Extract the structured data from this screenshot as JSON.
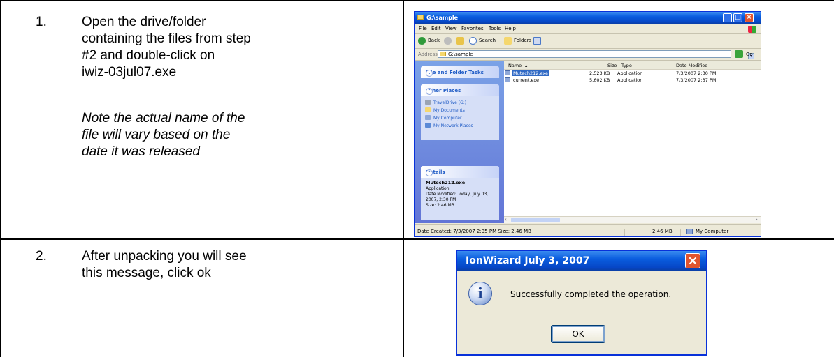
{
  "steps": [
    {
      "number": "1.",
      "lines": [
        "Open the drive/folder",
        "containing the files from step",
        "#2 and double-click on",
        "iwiz-03jul07.exe"
      ],
      "note_lines": [
        "Note the actual name of the",
        "file will vary based on the",
        "date it was released"
      ]
    },
    {
      "number": "2.",
      "lines": [
        "After unpacking you will see",
        "this message, click ok"
      ]
    }
  ],
  "explorer": {
    "title": "G:\\sample",
    "menu": [
      "File",
      "Edit",
      "View",
      "Favorites",
      "Tools",
      "Help"
    ],
    "toolbar": {
      "back": "Back",
      "search": "Search",
      "folders": "Folders"
    },
    "address": {
      "label": "Address",
      "path": "G:\\sample",
      "go": "Go"
    },
    "tasks": {
      "file_folder_tasks": "File and Folder Tasks",
      "other_places": "Other Places",
      "places": [
        "TravelDrive (G:)",
        "My Documents",
        "My Computer",
        "My Network Places"
      ],
      "details": {
        "header": "Details",
        "name": "Mutech212.exe",
        "type": "Application",
        "modified": "Date Modified: Today, July 03, 2007, 2:30 PM",
        "size": "Size: 2.46 MB"
      }
    },
    "columns": [
      "Name",
      "Size",
      "Type",
      "Date Modified"
    ],
    "files": [
      {
        "name": "Mutech212.exe",
        "size": "2,523 KB",
        "type": "Application",
        "modified": "7/3/2007 2:30 PM"
      },
      {
        "name": "current.exe",
        "size": "5,602 KB",
        "type": "Application",
        "modified": "7/3/2007 2:37 PM"
      }
    ],
    "status": {
      "left": "Date Created: 7/3/2007 2:35 PM Size: 2.46 MB",
      "size": "2.46 MB",
      "zone": "My Computer"
    }
  },
  "dialog": {
    "title": "IonWizard July 3, 2007",
    "message": "Successfully completed the operation.",
    "ok": "OK"
  }
}
